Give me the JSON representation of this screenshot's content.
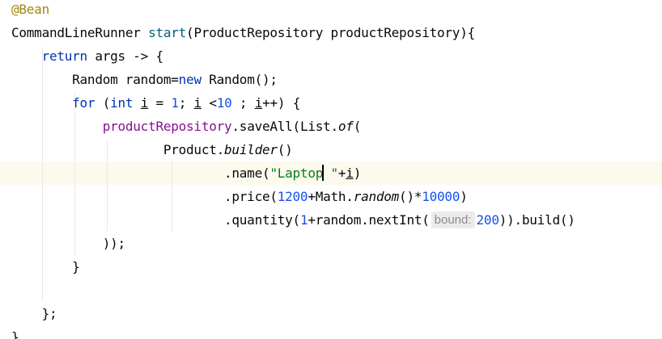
{
  "editor": {
    "language": "java",
    "caret_line": 8,
    "lines": [
      [
        {
          "t": "@Bean",
          "c": "ann"
        }
      ],
      [
        {
          "t": "CommandLineRunner "
        },
        {
          "t": "start",
          "c": "fn"
        },
        {
          "t": "(ProductRepository productRepository){"
        }
      ],
      [
        {
          "t": "    "
        },
        {
          "t": "return",
          "c": "kw"
        },
        {
          "t": " args -> {"
        }
      ],
      [
        {
          "t": "        Random random="
        },
        {
          "t": "new",
          "c": "kw"
        },
        {
          "t": " Random();"
        }
      ],
      [
        {
          "t": "        "
        },
        {
          "t": "for",
          "c": "kw"
        },
        {
          "t": " ("
        },
        {
          "t": "int",
          "c": "kw"
        },
        {
          "t": " "
        },
        {
          "t": "i",
          "c": "ul"
        },
        {
          "t": " = "
        },
        {
          "t": "1",
          "c": "num"
        },
        {
          "t": "; "
        },
        {
          "t": "i",
          "c": "ul"
        },
        {
          "t": " <"
        },
        {
          "t": "10",
          "c": "num"
        },
        {
          "t": " ; "
        },
        {
          "t": "i",
          "c": "ul"
        },
        {
          "t": "++) {"
        }
      ],
      [
        {
          "t": "            "
        },
        {
          "t": "productRepository",
          "c": "fld"
        },
        {
          "t": ".saveAll(List."
        },
        {
          "t": "of",
          "c": "it"
        },
        {
          "t": "("
        }
      ],
      [
        {
          "t": "                    Product."
        },
        {
          "t": "builder",
          "c": "it"
        },
        {
          "t": "()"
        }
      ],
      [
        {
          "t": "                            .name("
        },
        {
          "t": "\"Laptop",
          "c": "str"
        },
        {
          "caret": true
        },
        {
          "t": " \"",
          "c": "str"
        },
        {
          "t": "+"
        },
        {
          "t": "i",
          "c": "ul"
        },
        {
          "t": ")"
        }
      ],
      [
        {
          "t": "                            .price("
        },
        {
          "t": "1200",
          "c": "num"
        },
        {
          "t": "+Math."
        },
        {
          "t": "random",
          "c": "it"
        },
        {
          "t": "()*"
        },
        {
          "t": "10000",
          "c": "num"
        },
        {
          "t": ")"
        }
      ],
      [
        {
          "t": "                            .quantity("
        },
        {
          "t": "1",
          "c": "num"
        },
        {
          "t": "+random.nextInt("
        },
        {
          "hint": "bound:"
        },
        {
          "t": "200",
          "c": "num"
        },
        {
          "t": ")).build()"
        }
      ],
      [
        {
          "t": "            ));"
        }
      ],
      [
        {
          "t": "        }"
        }
      ],
      [],
      [
        {
          "t": "    };"
        }
      ],
      [
        {
          "t": "}"
        }
      ]
    ]
  }
}
